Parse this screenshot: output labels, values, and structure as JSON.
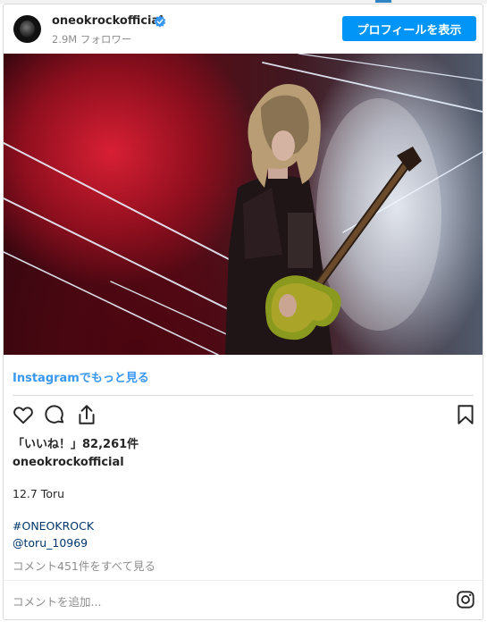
{
  "header": {
    "username": "oneokrockofficial",
    "followers": "2.9M フォロワー",
    "profile_button": "プロフィールを表示"
  },
  "post": {
    "image_alt": "Guitarist performing on stage with red and white lights",
    "more_link": "Instagramでもっと見る",
    "likes": "「いいね！」82,261件",
    "caption_user": "oneokrockofficial",
    "caption_line": "12.7 Toru",
    "hashtag": "#ONEOKROCK",
    "mention": "@toru_10969",
    "comments_link": "コメント451件をすべて見る",
    "comment_placeholder": "コメントを追加..."
  },
  "icons": {
    "like": "heart-icon",
    "comment": "comment-bubble-icon",
    "share": "share-icon",
    "save": "bookmark-icon",
    "instagram": "instagram-logo-icon",
    "verified": "verified-badge-icon"
  },
  "colors": {
    "accent": "#0095f6",
    "link": "#3897f0",
    "hashtag": "#003569",
    "muted": "#8e8e8e",
    "text": "#262626"
  }
}
